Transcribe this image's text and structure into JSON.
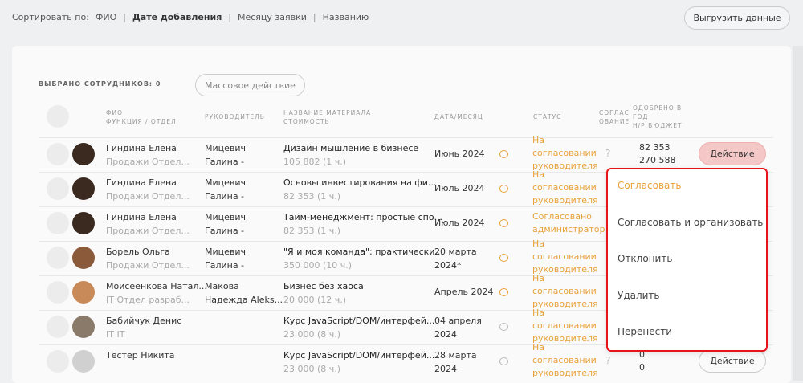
{
  "sort": {
    "label": "Сортировать по:",
    "options": [
      "ФИО",
      "Дате добавления",
      "Месяцу заявки",
      "Названию"
    ],
    "active": 1
  },
  "export_label": "Выгрузить данные",
  "selected_label": "ВЫБРАНО СОТРУДНИКОВ: 0",
  "mass_action_label": "Массовое действие",
  "headers": {
    "name": "ФИО",
    "func": "ФУНКЦИЯ / ОТДЕЛ",
    "manager": "РУКОВОДИТЕЛЬ",
    "material": "НАЗВАНИЕ МАТЕРИАЛА",
    "cost": "СТОИМОСТЬ",
    "date": "ДАТА/МЕСЯЦ",
    "status": "СТАТУС",
    "approval1": "СОГЛАС",
    "approval2": "ОВАНИЕ",
    "approved1": "ОДОБРЕНО В",
    "approved2": "ГОД",
    "budget": "Н/Р БЮДЖЕТ"
  },
  "rows": [
    {
      "name": "Гиндина Елена",
      "dept": "Продажи Отдел...",
      "mgr1": "Мицевич",
      "mgr2": "Галина -",
      "material": "Дизайн мышление в бизнесе",
      "cost": "105 882 (1 ч.)",
      "date1": "Июнь 2024",
      "date2": "",
      "status": [
        "На",
        "согласовании",
        "руководителя"
      ],
      "q": "?",
      "approved": "82 353",
      "budget": "270 588",
      "action": "Действие",
      "avatar": "#3a2a20",
      "comment": "orange"
    },
    {
      "name": "Гиндина Елена",
      "dept": "Продажи Отдел...",
      "mgr1": "Мицевич",
      "mgr2": "Галина -",
      "material": "Основы инвестирования на фи...",
      "cost": "82 353 (1 ч.)",
      "date1": "Июль 2024",
      "date2": "",
      "status": [
        "На",
        "согласовании",
        "руководителя"
      ],
      "avatar": "#3a2a20",
      "comment": "orange"
    },
    {
      "name": "Гиндина Елена",
      "dept": "Продажи Отдел...",
      "mgr1": "Мицевич",
      "mgr2": "Галина -",
      "material": "Тайм-менеджмент: простые спо...",
      "cost": "82 353 (1 ч.)",
      "date1": "Июль 2024",
      "date2": "",
      "status": [
        "Согласовано",
        "администратор"
      ],
      "avatar": "#3a2a20",
      "comment": "orange"
    },
    {
      "name": "Борель Ольга",
      "dept": "Продажи Отдел...",
      "mgr1": "Мицевич",
      "mgr2": "Галина -",
      "material": "\"Я и моя команда\": практически...",
      "cost": "350 000 (10 ч.)",
      "date1": "20 марта",
      "date2": "2024*",
      "status": [
        "На",
        "согласовании",
        "руководителя"
      ],
      "avatar": "#8a5a3a",
      "comment": "orange"
    },
    {
      "name": "Моисеенкова Натал...",
      "dept": "IT Отдел разраб...",
      "mgr1": "Макова",
      "mgr2": "Надежда Aleks...",
      "material": "Бизнес без хаоса",
      "cost": "20 000 (12 ч.)",
      "date1": "Апрель 2024",
      "date2": "",
      "status": [
        "На",
        "согласовании",
        "руководителя"
      ],
      "avatar": "#c98a5a",
      "comment": "orange"
    },
    {
      "name": "Бабийчук Денис",
      "dept": "IT IT",
      "mgr1": "",
      "mgr2": "",
      "material": "Курс JavaScript/DOM/интерфей...",
      "cost": "23 000 (8 ч.)",
      "date1": "04 апреля",
      "date2": "2024",
      "status": [
        "На",
        "согласовании",
        "руководителя"
      ],
      "avatar": "#8a7a6a",
      "comment": "gray"
    },
    {
      "name": "Тестер Никита",
      "dept": "",
      "mgr1": "",
      "mgr2": "",
      "material": "Курс JavaScript/DOM/интерфей...",
      "cost": "23 000 (8 ч.)",
      "date1": "28 марта",
      "date2": "2024",
      "status": [
        "На",
        "согласовании",
        "руководителя"
      ],
      "q": "?",
      "approved": "0",
      "budget": "0",
      "action": "Действие",
      "avatar": "#d0d0d0",
      "comment": "gray"
    }
  ],
  "menu": [
    "Согласовать",
    "Согласовать и организовать",
    "Отклонить",
    "Удалить",
    "Перенести"
  ]
}
